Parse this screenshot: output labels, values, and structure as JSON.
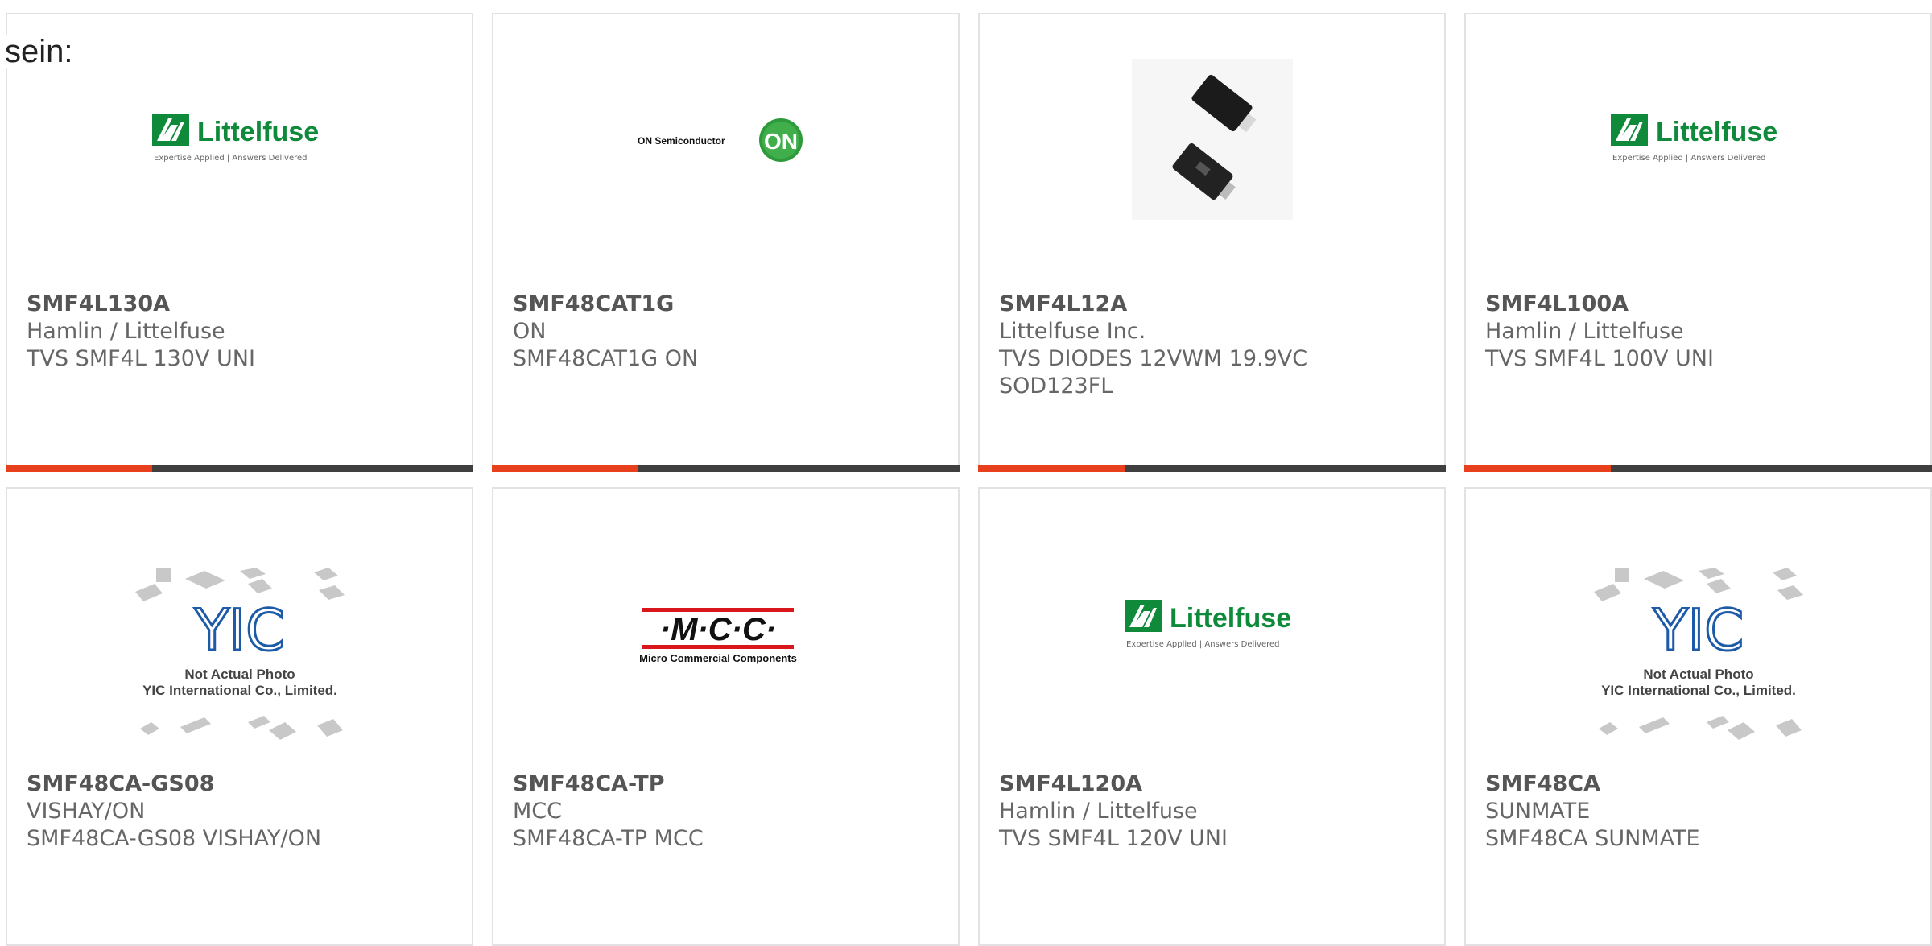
{
  "intro": "sein:",
  "colors": {
    "accent_bar": "#e8401c",
    "dark_bar": "#3f3f3f",
    "littelfuse_green": "#0e8a3a",
    "on_green": "#2e9a3c",
    "mcc_red": "#d8161c",
    "yic_blue": "#1d5aa8"
  },
  "products": [
    {
      "part": "SMF4L130A",
      "manufacturer": "Hamlin / Littelfuse",
      "description": "TVS SMF4L 130V UNI",
      "image": "littelfuse-logo"
    },
    {
      "part": "SMF48CAT1G",
      "manufacturer": "ON",
      "description": "SMF48CAT1G ON",
      "image": "on-semiconductor-logo"
    },
    {
      "part": "SMF4L12A",
      "manufacturer": "Littelfuse Inc.",
      "description": "TVS DIODES 12VWM 19.9VC SOD123FL",
      "image": "diode-package-photo"
    },
    {
      "part": "SMF4L100A",
      "manufacturer": "Hamlin / Littelfuse",
      "description": "TVS SMF4L 100V UNI",
      "image": "littelfuse-logo"
    },
    {
      "part": "SMF48CA-GS08",
      "manufacturer": "VISHAY/ON",
      "description": "SMF48CA-GS08 VISHAY/ON",
      "image": "yic-placeholder"
    },
    {
      "part": "SMF48CA-TP",
      "manufacturer": "MCC",
      "description": "SMF48CA-TP MCC",
      "image": "mcc-logo"
    },
    {
      "part": "SMF4L120A",
      "manufacturer": "Hamlin / Littelfuse",
      "description": "TVS SMF4L 120V UNI",
      "image": "littelfuse-logo"
    },
    {
      "part": "SMF48CA",
      "manufacturer": "SUNMATE",
      "description": "SMF48CA SUNMATE",
      "image": "yic-placeholder"
    }
  ],
  "logos": {
    "littelfuse": {
      "name": "Littelfuse",
      "tagline": "Expertise Applied | Answers Delivered"
    },
    "on": {
      "name": "ON Semiconductor",
      "badge": "ON"
    },
    "mcc": {
      "name": "·M·C·C·",
      "tagline": "Micro Commercial Components"
    },
    "yic": {
      "mark": "YIC",
      "line1": "Not Actual Photo",
      "line2": "YIC International Co., Limited."
    }
  }
}
